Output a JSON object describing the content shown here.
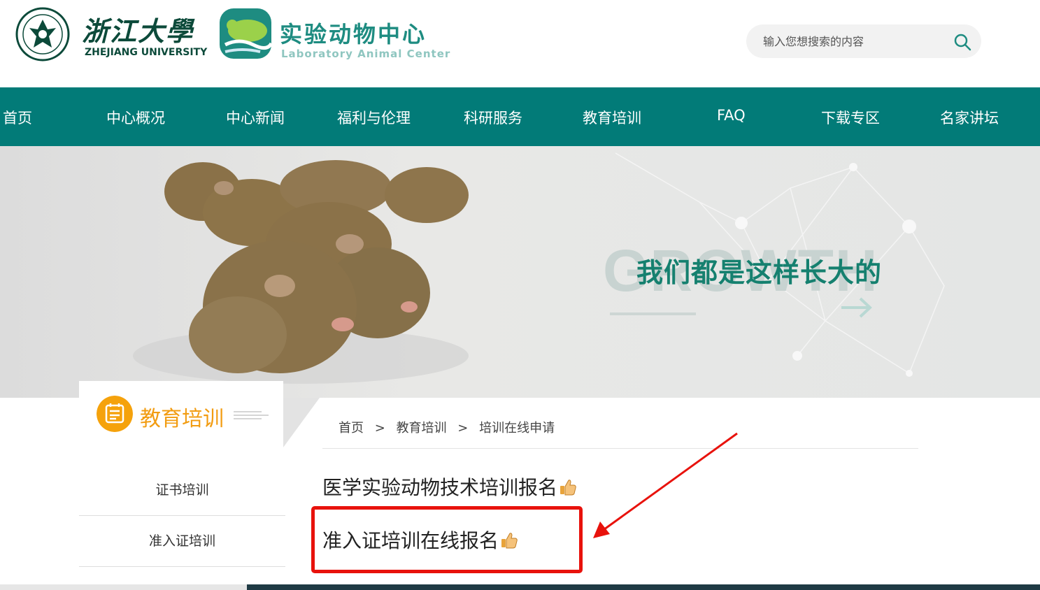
{
  "header": {
    "zju_name_cn": "浙江大學",
    "zju_name_en": "ZHEJIANG UNIVERSITY",
    "center_name_cn": "实验动物中心",
    "center_name_en": "Laboratory Animal Center",
    "search_placeholder": "输入您想搜索的内容"
  },
  "nav": {
    "items": [
      "首页",
      "中心概况",
      "中心新闻",
      "福利与伦理",
      "科研服务",
      "教育培训",
      "FAQ",
      "下载专区",
      "名家讲坛"
    ]
  },
  "banner": {
    "slogan": "我们都是这样长大的",
    "watermark": "GROWTH"
  },
  "sidebar": {
    "title": "教育培训",
    "items": [
      "证书培训",
      "准入证培训"
    ]
  },
  "breadcrumb": {
    "items": [
      "首页",
      "教育培训",
      "培训在线申请"
    ],
    "separator": ">"
  },
  "main": {
    "links": [
      "医学实验动物技术培训报名",
      "准入证培训在线报名"
    ]
  },
  "colors": {
    "brand_teal": "#027b78",
    "accent_orange": "#f29c11",
    "annotation_red": "#e8120c"
  }
}
